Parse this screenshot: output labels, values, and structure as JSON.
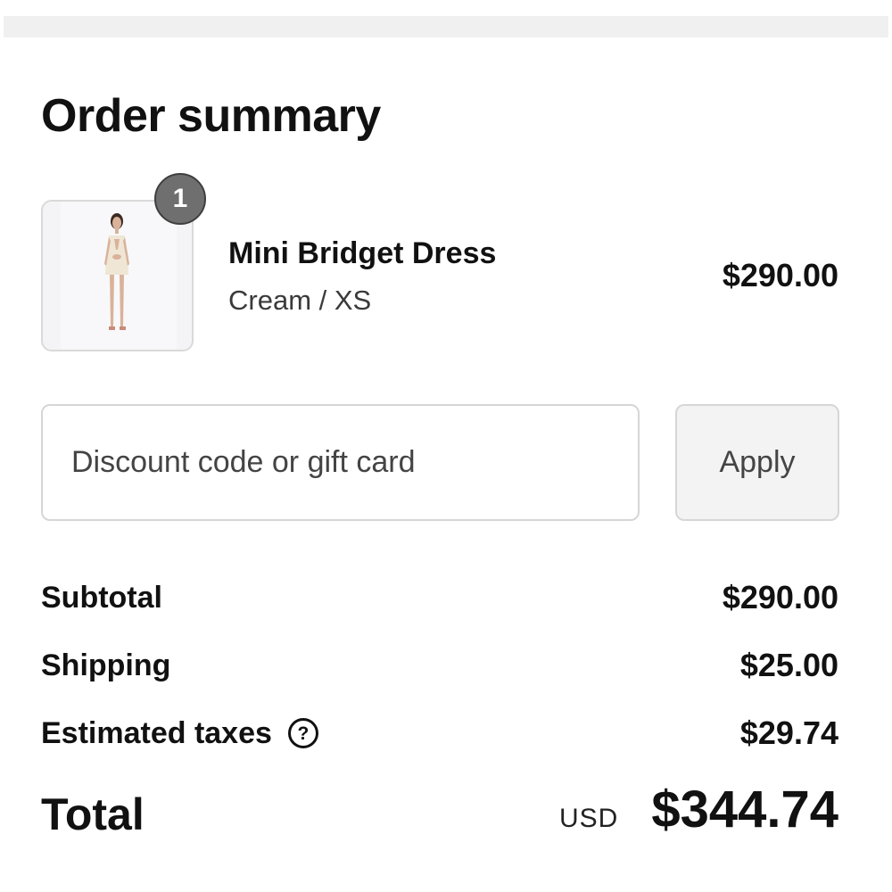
{
  "summary": {
    "title": "Order summary"
  },
  "line_item": {
    "quantity": "1",
    "name": "Mini Bridget Dress",
    "variant": "Cream / XS",
    "price": "$290.00"
  },
  "discount": {
    "placeholder": "Discount code or gift card",
    "value": "",
    "apply_label": "Apply"
  },
  "totals": {
    "subtotal_label": "Subtotal",
    "subtotal_value": "$290.00",
    "shipping_label": "Shipping",
    "shipping_value": "$25.00",
    "taxes_label": "Estimated taxes",
    "taxes_value": "$29.74",
    "help_glyph": "?",
    "total_label": "Total",
    "currency": "USD",
    "total_value": "$344.74"
  },
  "icons": {
    "help": "question-circle-icon"
  },
  "colors": {
    "text": "#111111",
    "badge": "#6f6f6f",
    "border": "#d6d6d6",
    "button_bg": "#f3f3f3"
  }
}
